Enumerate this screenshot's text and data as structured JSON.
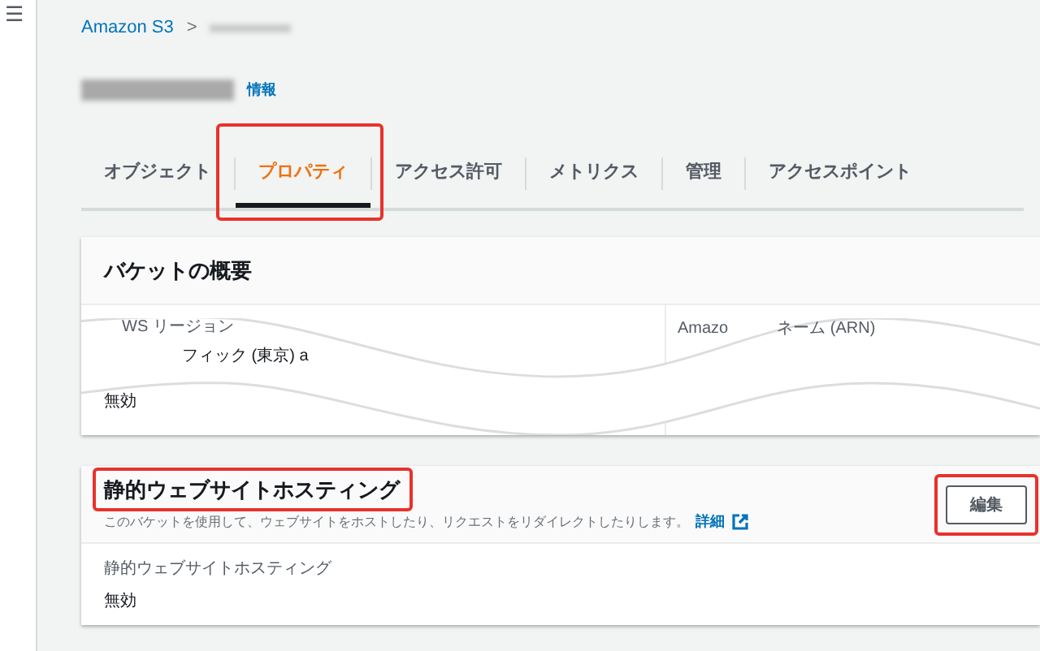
{
  "menu_icon": "☰",
  "breadcrumb": {
    "root": "Amazon S3",
    "separator": ">"
  },
  "title": {
    "info_link": "情報"
  },
  "tabs": [
    {
      "label": "オブジェクト",
      "selected": false,
      "highlighted": false
    },
    {
      "label": "プロパティ",
      "selected": true,
      "highlighted": true
    },
    {
      "label": "アクセス許可",
      "selected": false,
      "highlighted": false
    },
    {
      "label": "メトリクス",
      "selected": false,
      "highlighted": false
    },
    {
      "label": "管理",
      "selected": false,
      "highlighted": false
    },
    {
      "label": "アクセスポイント",
      "selected": false,
      "highlighted": false
    }
  ],
  "overview": {
    "heading": "バケットの概要",
    "region_label": "WS リージョン",
    "region_value": "フィック (東京) a",
    "arn_label_start": "Amazo",
    "arn_label_end": "ネーム (ARN)",
    "versioning_value": "無効"
  },
  "hosting": {
    "heading": "静的ウェブサイトホスティング",
    "heading_highlighted": true,
    "description": "このバケットを使用して、ウェブサイトをホストしたり、リクエストをリダイレクトしたりします。",
    "detail_link": "詳細",
    "edit_button": "編集",
    "edit_highlighted": true,
    "field_label": "静的ウェブサイトホスティング",
    "field_value": "無効"
  }
}
